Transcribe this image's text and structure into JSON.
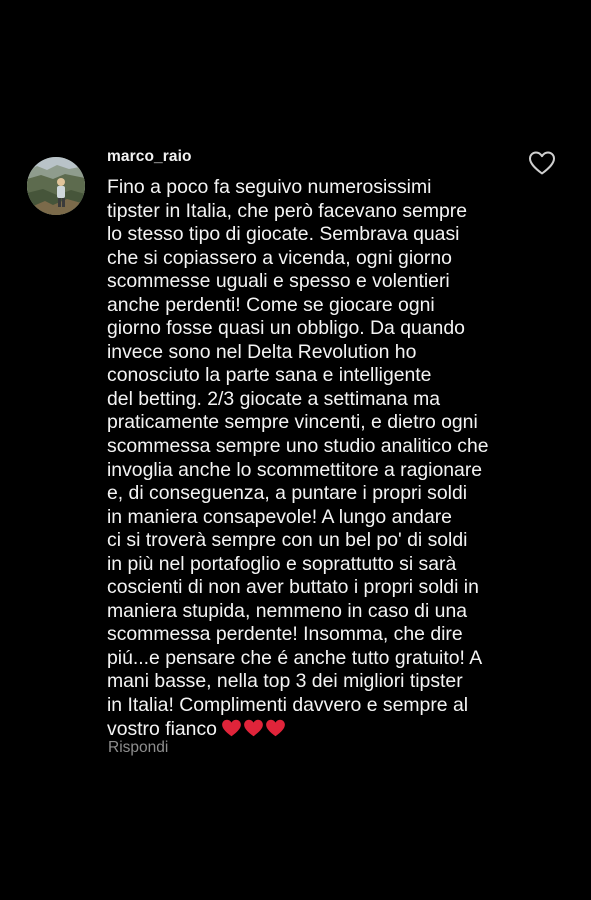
{
  "comment": {
    "username": "marco_raio",
    "lines": [
      "Fino a poco fa seguivo numerosissimi",
      "tipster in Italia, che però facevano sempre",
      "lo stesso tipo di giocate. Sembrava quasi",
      "che si copiassero a vicenda, ogni giorno",
      "scommesse uguali e spesso e volentieri",
      "anche perdenti! Come se giocare ogni",
      "giorno fosse quasi un obbligo. Da quando",
      "invece sono nel Delta Revolution ho",
      "conosciuto la parte sana e intelligente",
      "del betting. 2/3 giocate a settimana ma",
      "praticamente sempre vincenti, e dietro ogni",
      "scommessa sempre uno studio analitico che",
      "invoglia anche lo scommettitore a ragionare",
      "e, di conseguenza, a puntare i propri soldi",
      "in maniera consapevole! A lungo andare",
      "ci si troverà sempre con un bel po' di soldi",
      "in più nel portafoglio e soprattutto si sarà",
      "coscienti di non aver buttato i propri soldi in",
      "maniera stupida, nemmeno in caso di una",
      "scommessa perdente! Insomma, che dire",
      "piú...e pensare che é anche tutto gratuito! A",
      "mani basse, nella top 3 dei migliori tipster",
      "in Italia! Complimenti davvero e sempre al",
      "vostro fianco"
    ],
    "heart_emoji_color": "#e0243a",
    "heart_emoji_count": 3,
    "reply_label": "Rispondi",
    "like_icon": "heart-outline-icon"
  },
  "colors": {
    "background": "#000000",
    "text": "#f4f4f4",
    "muted": "#8e8e8e"
  }
}
